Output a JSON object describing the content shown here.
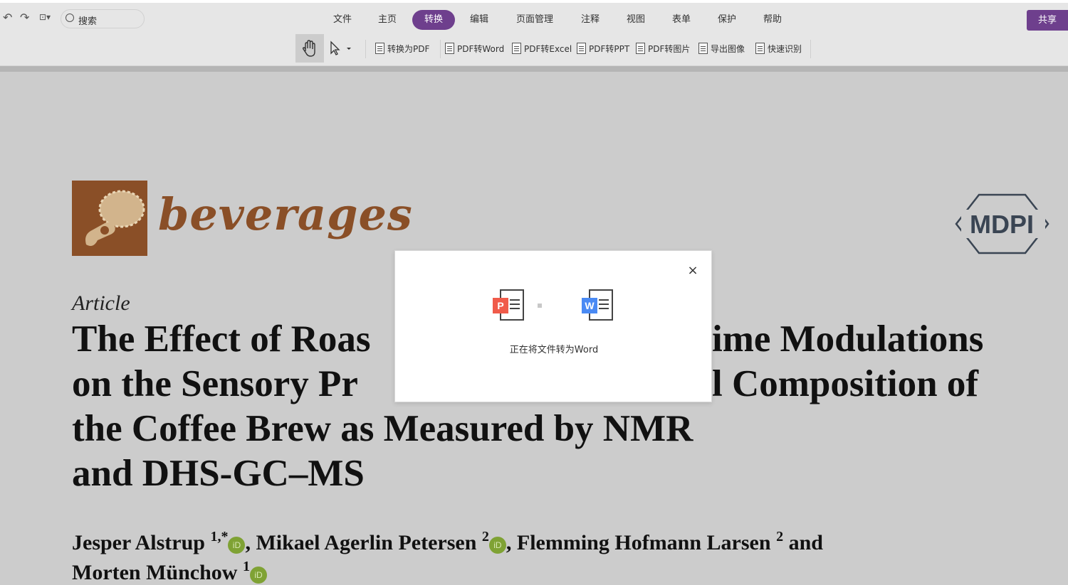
{
  "topbar": {
    "search_placeholder": "搜索",
    "menu": [
      "文件",
      "主页",
      "转换",
      "编辑",
      "页面管理",
      "注释",
      "视图",
      "表单",
      "保护",
      "帮助"
    ],
    "active_menu": "转换",
    "share_label": "共享",
    "accent_color": "#6e3f8d"
  },
  "toolbar": {
    "buttons": [
      "转换为PDF",
      "PDF转Word",
      "PDF转Excel",
      "PDF转PPT",
      "PDF转图片",
      "导出图像",
      "快速识别"
    ]
  },
  "document": {
    "journal": "beverages",
    "publisher": "MDPI",
    "article_type": "Article",
    "title_lines": [
      "The Effect of Roas",
      "ime Modulations",
      "on the Sensory Pr",
      "l Composition of",
      "the Coffee Brew as Measured by NMR",
      "and DHS-GC–MS"
    ],
    "authors_line1": {
      "a1": "Jesper Alstrup",
      "a1_sup": "1,*",
      "a2": ", Mikael Agerlin Petersen",
      "a2_sup": "2",
      "a3": ", Flemming Hofmann Larsen",
      "a3_sup": "2",
      "tail": " and"
    },
    "authors_line2": {
      "a4": "Morten Münchow",
      "a4_sup": "1"
    },
    "orcid_label": "iD"
  },
  "dialog": {
    "from_badge": "P",
    "to_badge": "W",
    "from_color": "#f05b4a",
    "to_color": "#4a8af4",
    "message": "正在将文件转为Word",
    "close_symbol": "×"
  }
}
